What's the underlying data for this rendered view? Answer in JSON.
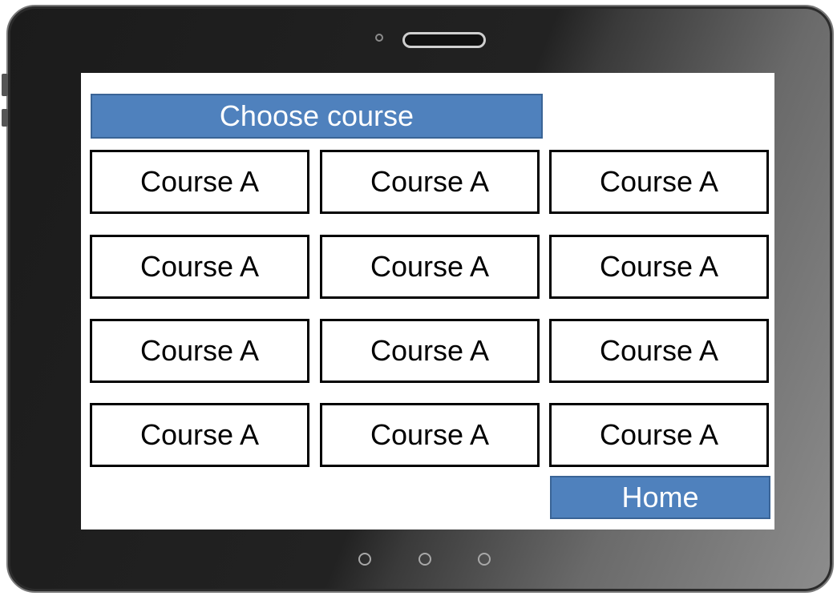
{
  "screen": {
    "title": "Choose course",
    "courses": [
      "Course A",
      "Course A",
      "Course A",
      "Course A",
      "Course A",
      "Course A",
      "Course A",
      "Course A",
      "Course A",
      "Course A",
      "Course A",
      "Course A"
    ],
    "home_label": "Home"
  },
  "colors": {
    "accent": "#4f81bd",
    "accent_border": "#3a6496",
    "screen_bg": "#ffffff",
    "bezel": "#1b1b1b"
  },
  "icons": {
    "camera": "camera-icon",
    "speaker": "speaker-icon",
    "nav_buttons": [
      "back-button-icon",
      "home-button-icon",
      "menu-button-icon"
    ]
  }
}
